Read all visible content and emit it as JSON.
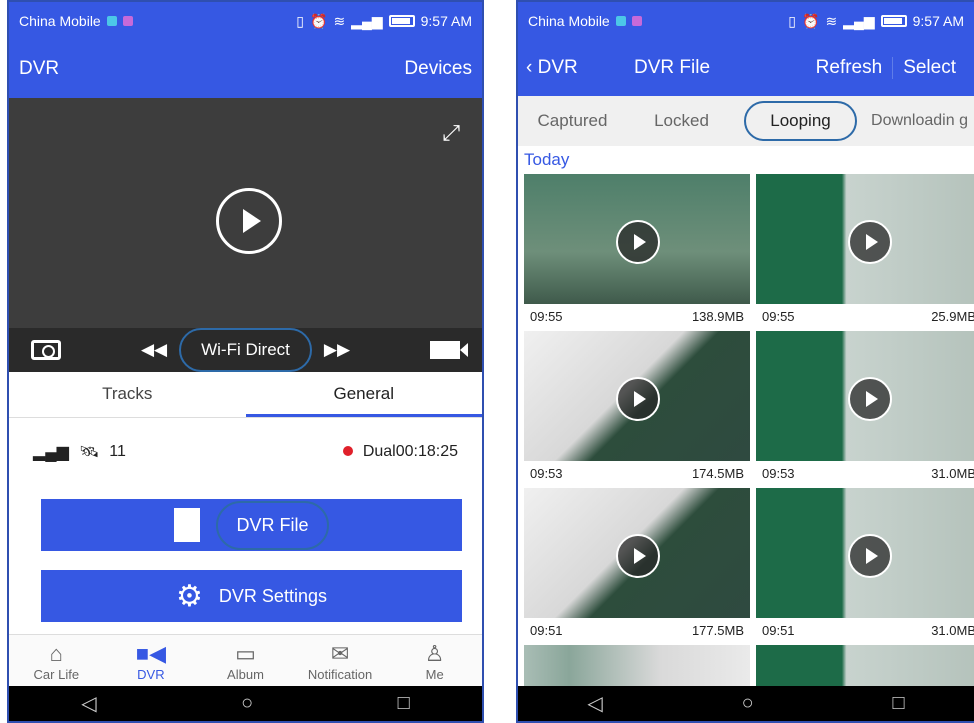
{
  "left_phone": {
    "status": {
      "carrier": "China Mobile",
      "time": "9:57 AM"
    },
    "appbar": {
      "title": "DVR",
      "devices": "Devices"
    },
    "video": {
      "mode_label": "Wi-Fi Direct"
    },
    "tabs": {
      "tracks": "Tracks",
      "general": "General"
    },
    "info": {
      "satellites": "11",
      "recording": "Dual00:18:25"
    },
    "buttons": {
      "dvr_file": "DVR File",
      "dvr_settings": "DVR Settings"
    },
    "bottom_nav": {
      "car_life": "Car Life",
      "dvr": "DVR",
      "album": "Album",
      "notification": "Notification",
      "me": "Me"
    }
  },
  "right_phone": {
    "status": {
      "carrier": "China Mobile",
      "time": "9:57 AM"
    },
    "appbar": {
      "back": "DVR",
      "title": "DVR File",
      "refresh": "Refresh",
      "select": "Select"
    },
    "tabs": {
      "captured": "Captured",
      "locked": "Locked",
      "looping": "Looping",
      "downloading": "Downloadin g"
    },
    "section": "Today",
    "files": [
      {
        "time": "09:55",
        "size": "138.9MB"
      },
      {
        "time": "09:55",
        "size": "25.9MB"
      },
      {
        "time": "09:53",
        "size": "174.5MB"
      },
      {
        "time": "09:53",
        "size": "31.0MB"
      },
      {
        "time": "09:51",
        "size": "177.5MB"
      },
      {
        "time": "09:51",
        "size": "31.0MB"
      }
    ]
  }
}
